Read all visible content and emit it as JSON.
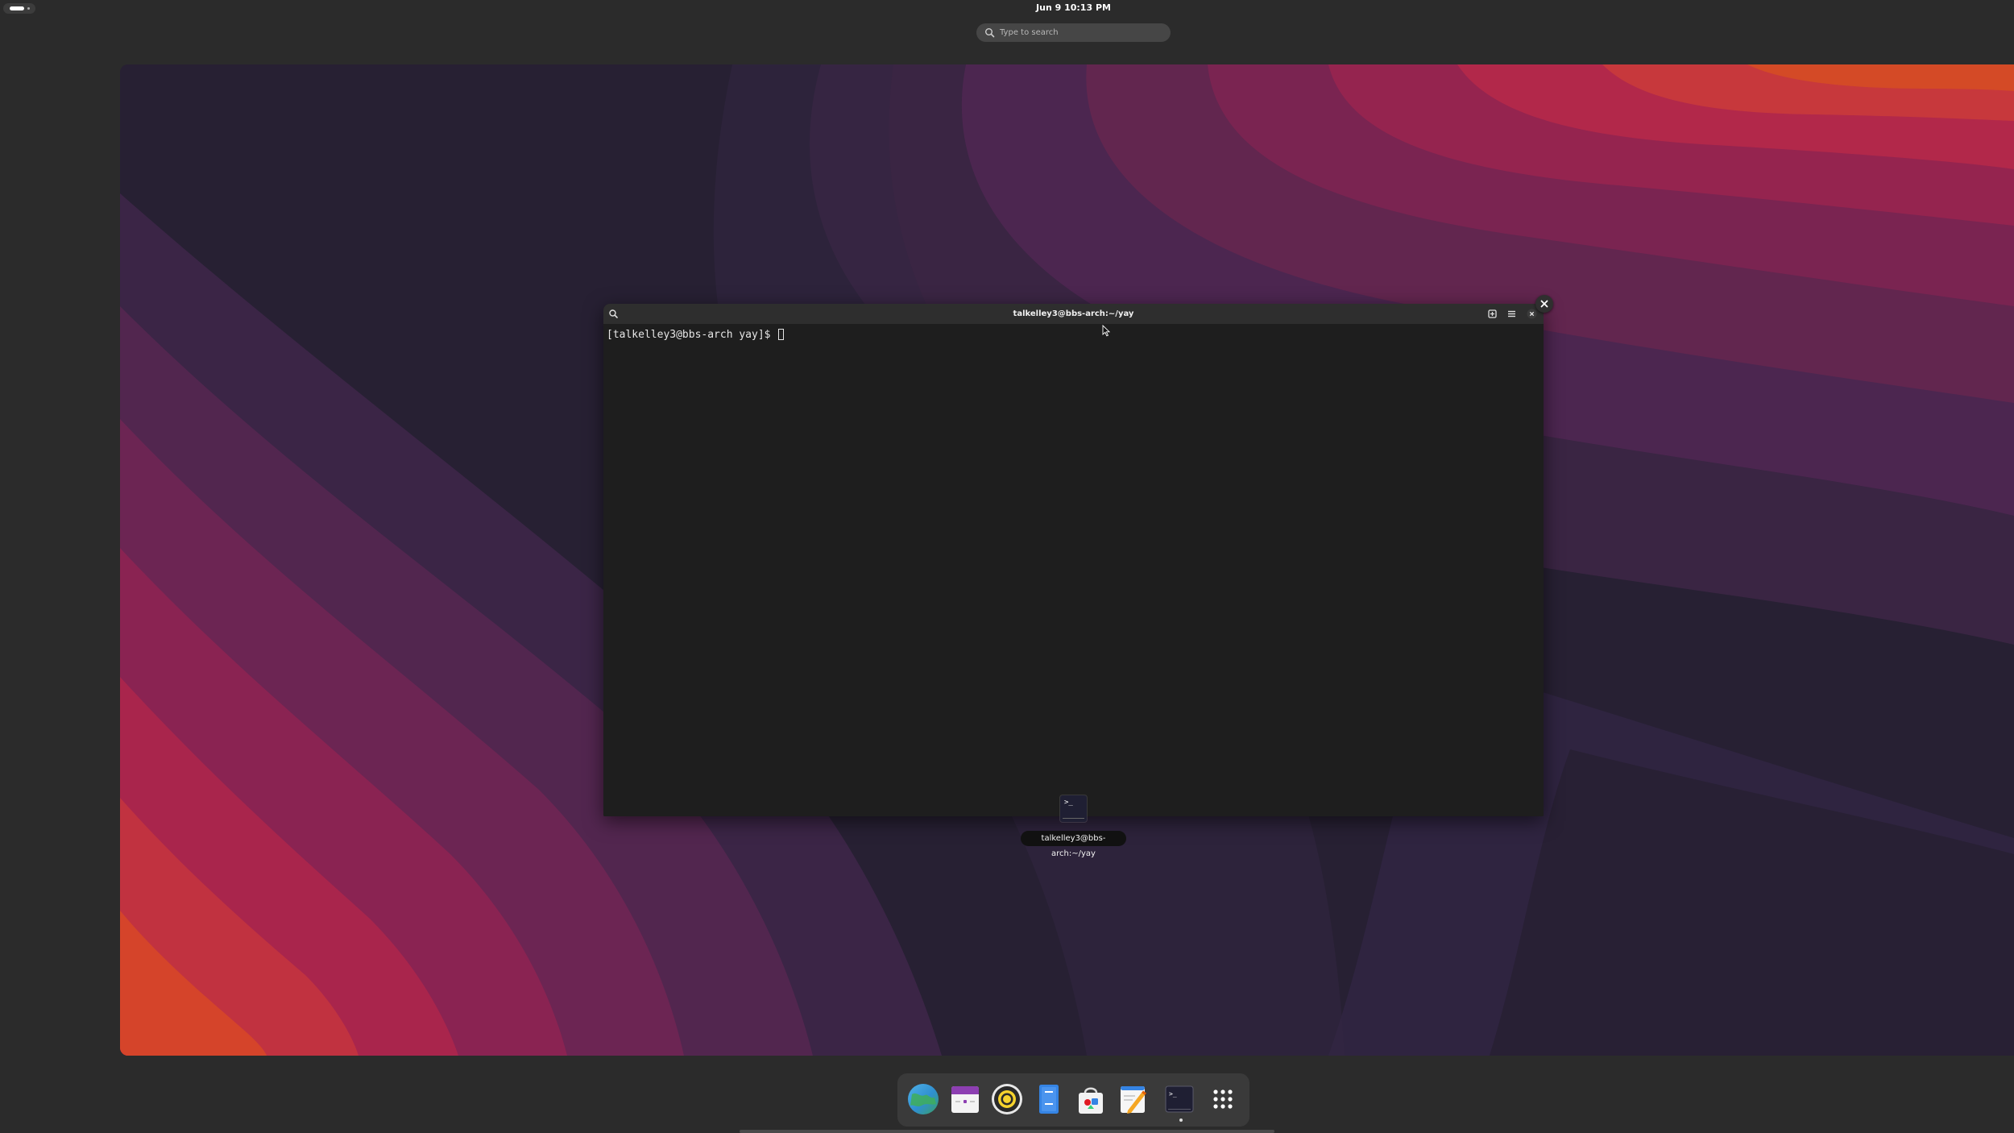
{
  "top_bar": {
    "clock": "Jun 9  10:13 PM",
    "search_placeholder": "Type to search"
  },
  "terminal": {
    "title": "talkelley3@bbs-arch:~/yay",
    "prompt": "[talkelley3@bbs-arch yay]$ "
  },
  "window_caption": "talkelley3@bbs-arch:~/yay",
  "app_thumbnail_glyph": ">_",
  "dock": {
    "items": [
      {
        "name": "web-browser",
        "icon": "globe-icon"
      },
      {
        "name": "calendar",
        "icon": "calendar-icon"
      },
      {
        "name": "rhythmbox",
        "icon": "music-player-icon"
      },
      {
        "name": "text-editor-notes",
        "icon": "document-icon"
      },
      {
        "name": "software-store",
        "icon": "shopping-bag-icon"
      },
      {
        "name": "text-editor",
        "icon": "pencil-notepad-icon"
      },
      {
        "name": "terminal",
        "icon": "terminal-icon",
        "running": true
      },
      {
        "name": "show-apps",
        "icon": "app-grid-icon"
      }
    ],
    "terminal_glyph": ">_"
  },
  "colors": {
    "panel_bg": "#2b2b2b",
    "terminal_bg": "#1e1e1e",
    "wallpaper_dark": "#262033",
    "wallpaper_magenta": "#8a2352",
    "wallpaper_orange": "#d8461f"
  }
}
